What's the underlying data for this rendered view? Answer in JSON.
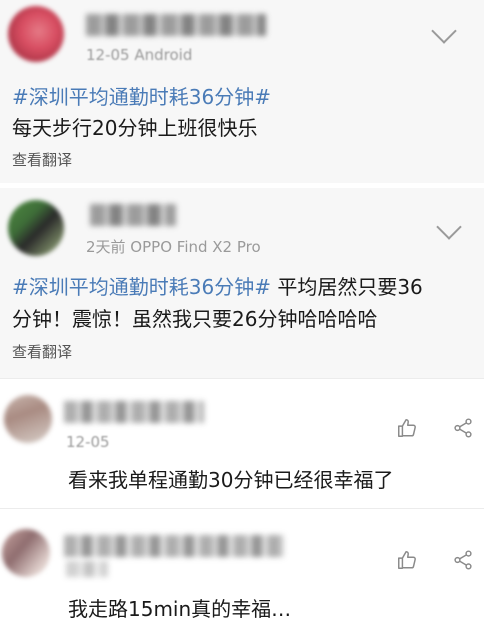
{
  "colors": {
    "hashtag": "#4a7bb7",
    "meta": "#9a9a9a",
    "text": "#1a1a1a",
    "card_bg": "#f7f7f7"
  },
  "posts": [
    {
      "meta": "12-05   Android",
      "hashtag": "#深圳平均通勤时耗36分钟#",
      "line1_rest": "",
      "line2": "每天步行20分钟上班很快乐",
      "translate": "查看翻译",
      "menu_icon": "chevron-down-icon"
    },
    {
      "meta": "2天前   OPPO Find X2 Pro",
      "hashtag": "#深圳平均通勤时耗36分钟#",
      "line1_rest": " 平均居然只要36",
      "line2": "分钟！震惊！虽然我只要26分钟哈哈哈哈",
      "translate": "查看翻译",
      "menu_icon": "chevron-down-icon"
    }
  ],
  "comments": [
    {
      "meta": "12-05",
      "text": "看来我单程通勤30分钟已经很幸福了",
      "like_icon": "thumbs-up-icon",
      "share_icon": "share-icon"
    },
    {
      "meta": "",
      "text": "我走路15min真的幸福…",
      "like_icon": "thumbs-up-icon",
      "share_icon": "share-icon"
    }
  ]
}
